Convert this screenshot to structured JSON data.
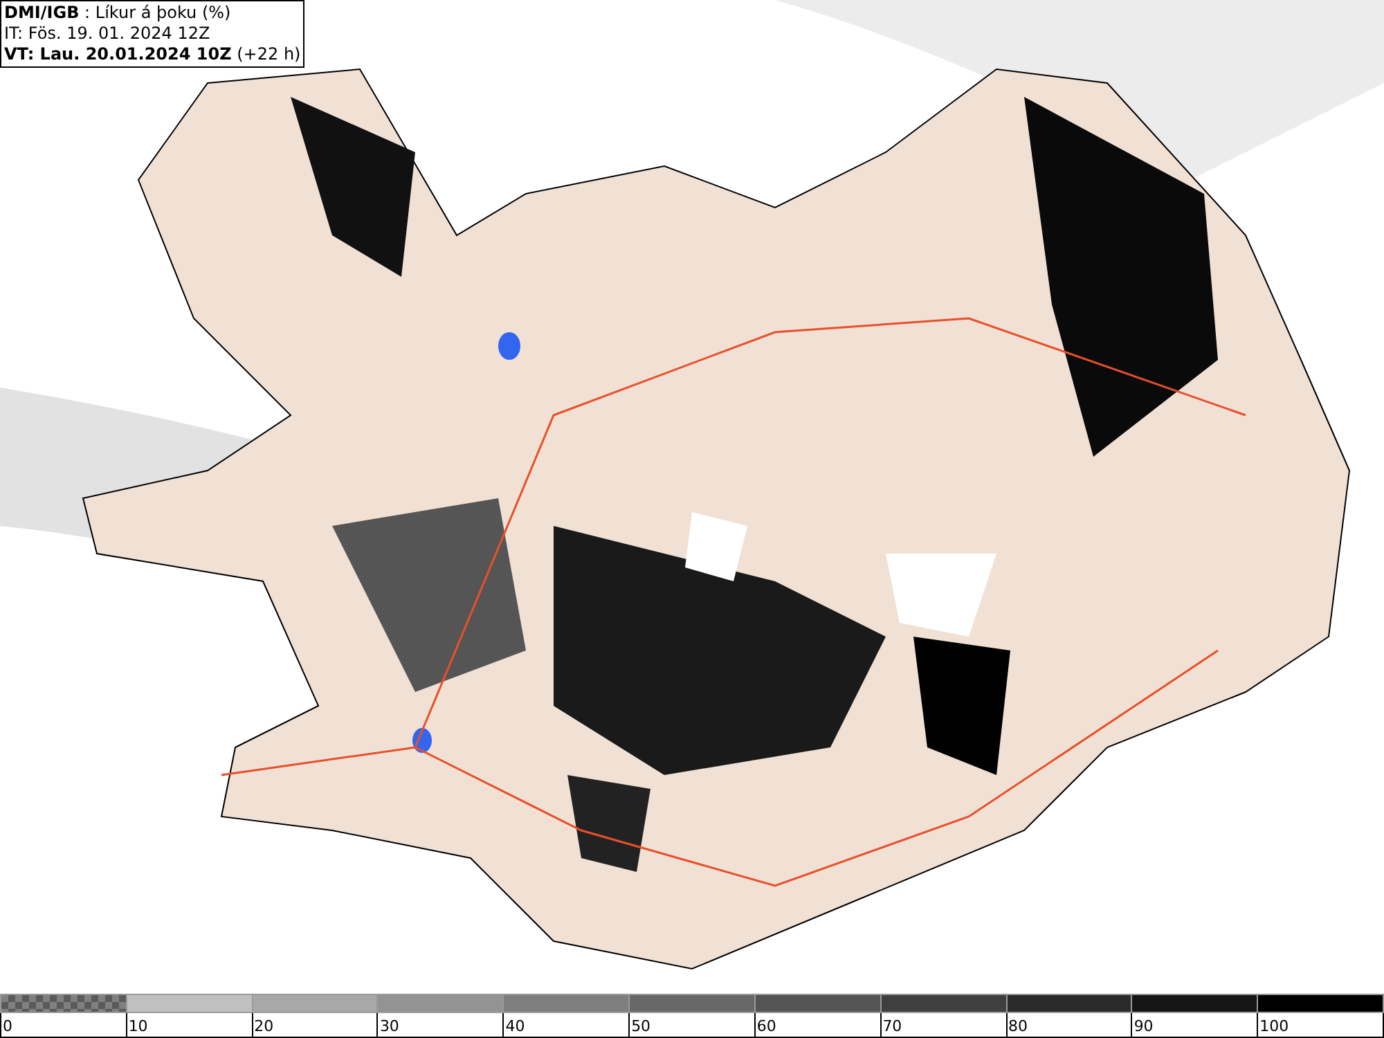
{
  "header": {
    "lines": [
      "**DMI/IGB** : Líkur á þoku (%)",
      "IT: Fös. 19. 01. 2024 12Z",
      "**VT: Lau. 20.01.2024 10Z** (+22 h)"
    ]
  },
  "legend": {
    "segments": [
      {
        "kind": "checkered",
        "color": "#808080"
      },
      {
        "kind": "solid",
        "color": "#c0c0c0"
      },
      {
        "kind": "solid",
        "color": "#a8a8a8"
      },
      {
        "kind": "solid",
        "color": "#939393"
      },
      {
        "kind": "solid",
        "color": "#7e7e7e"
      },
      {
        "kind": "solid",
        "color": "#686868"
      },
      {
        "kind": "solid",
        "color": "#545454"
      },
      {
        "kind": "solid",
        "color": "#3f3f3f"
      },
      {
        "kind": "solid",
        "color": "#2a2a2a"
      },
      {
        "kind": "solid",
        "color": "#151515"
      },
      {
        "kind": "solid",
        "color": "#000000"
      }
    ],
    "labels": [
      "0",
      "10",
      "20",
      "30",
      "40",
      "50",
      "60",
      "70",
      "80",
      "90",
      "100"
    ]
  }
}
